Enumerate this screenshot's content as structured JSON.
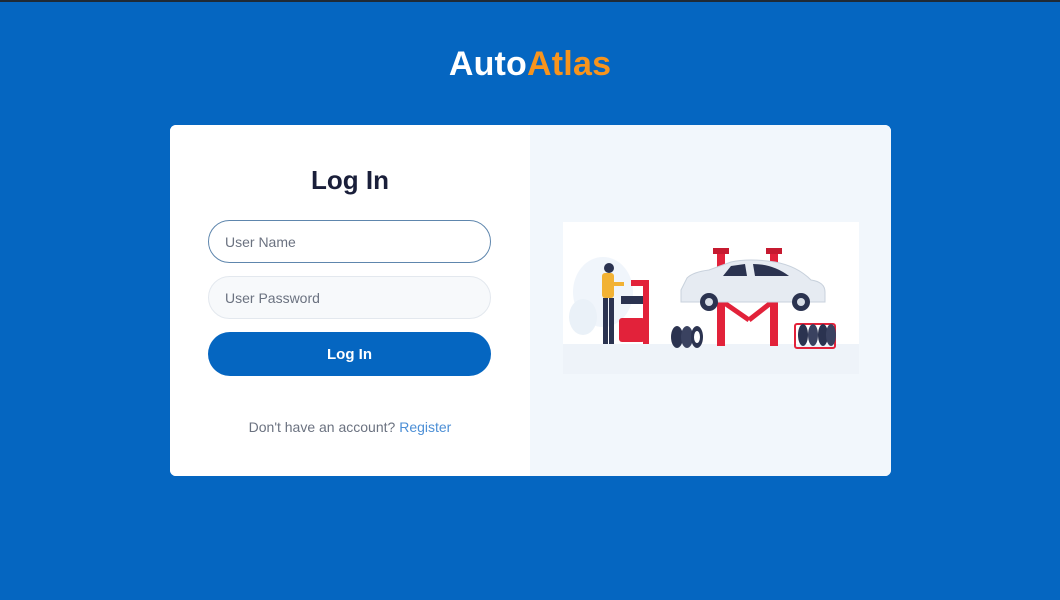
{
  "brand": {
    "part1": "Auto",
    "part2": "Atlas"
  },
  "login": {
    "title": "Log In",
    "username_placeholder": "User Name",
    "password_placeholder": "User Password",
    "submit_label": "Log In",
    "register_prompt": "Don't have an account?",
    "register_link": "Register"
  },
  "colors": {
    "background": "#0566c1",
    "brand_accent": "#f7941d",
    "button": "#0566c1",
    "link": "#4c8fd6",
    "lift_red": "#e2223a"
  },
  "illustration": {
    "subject": "mechanic-car-lift-illustration"
  }
}
